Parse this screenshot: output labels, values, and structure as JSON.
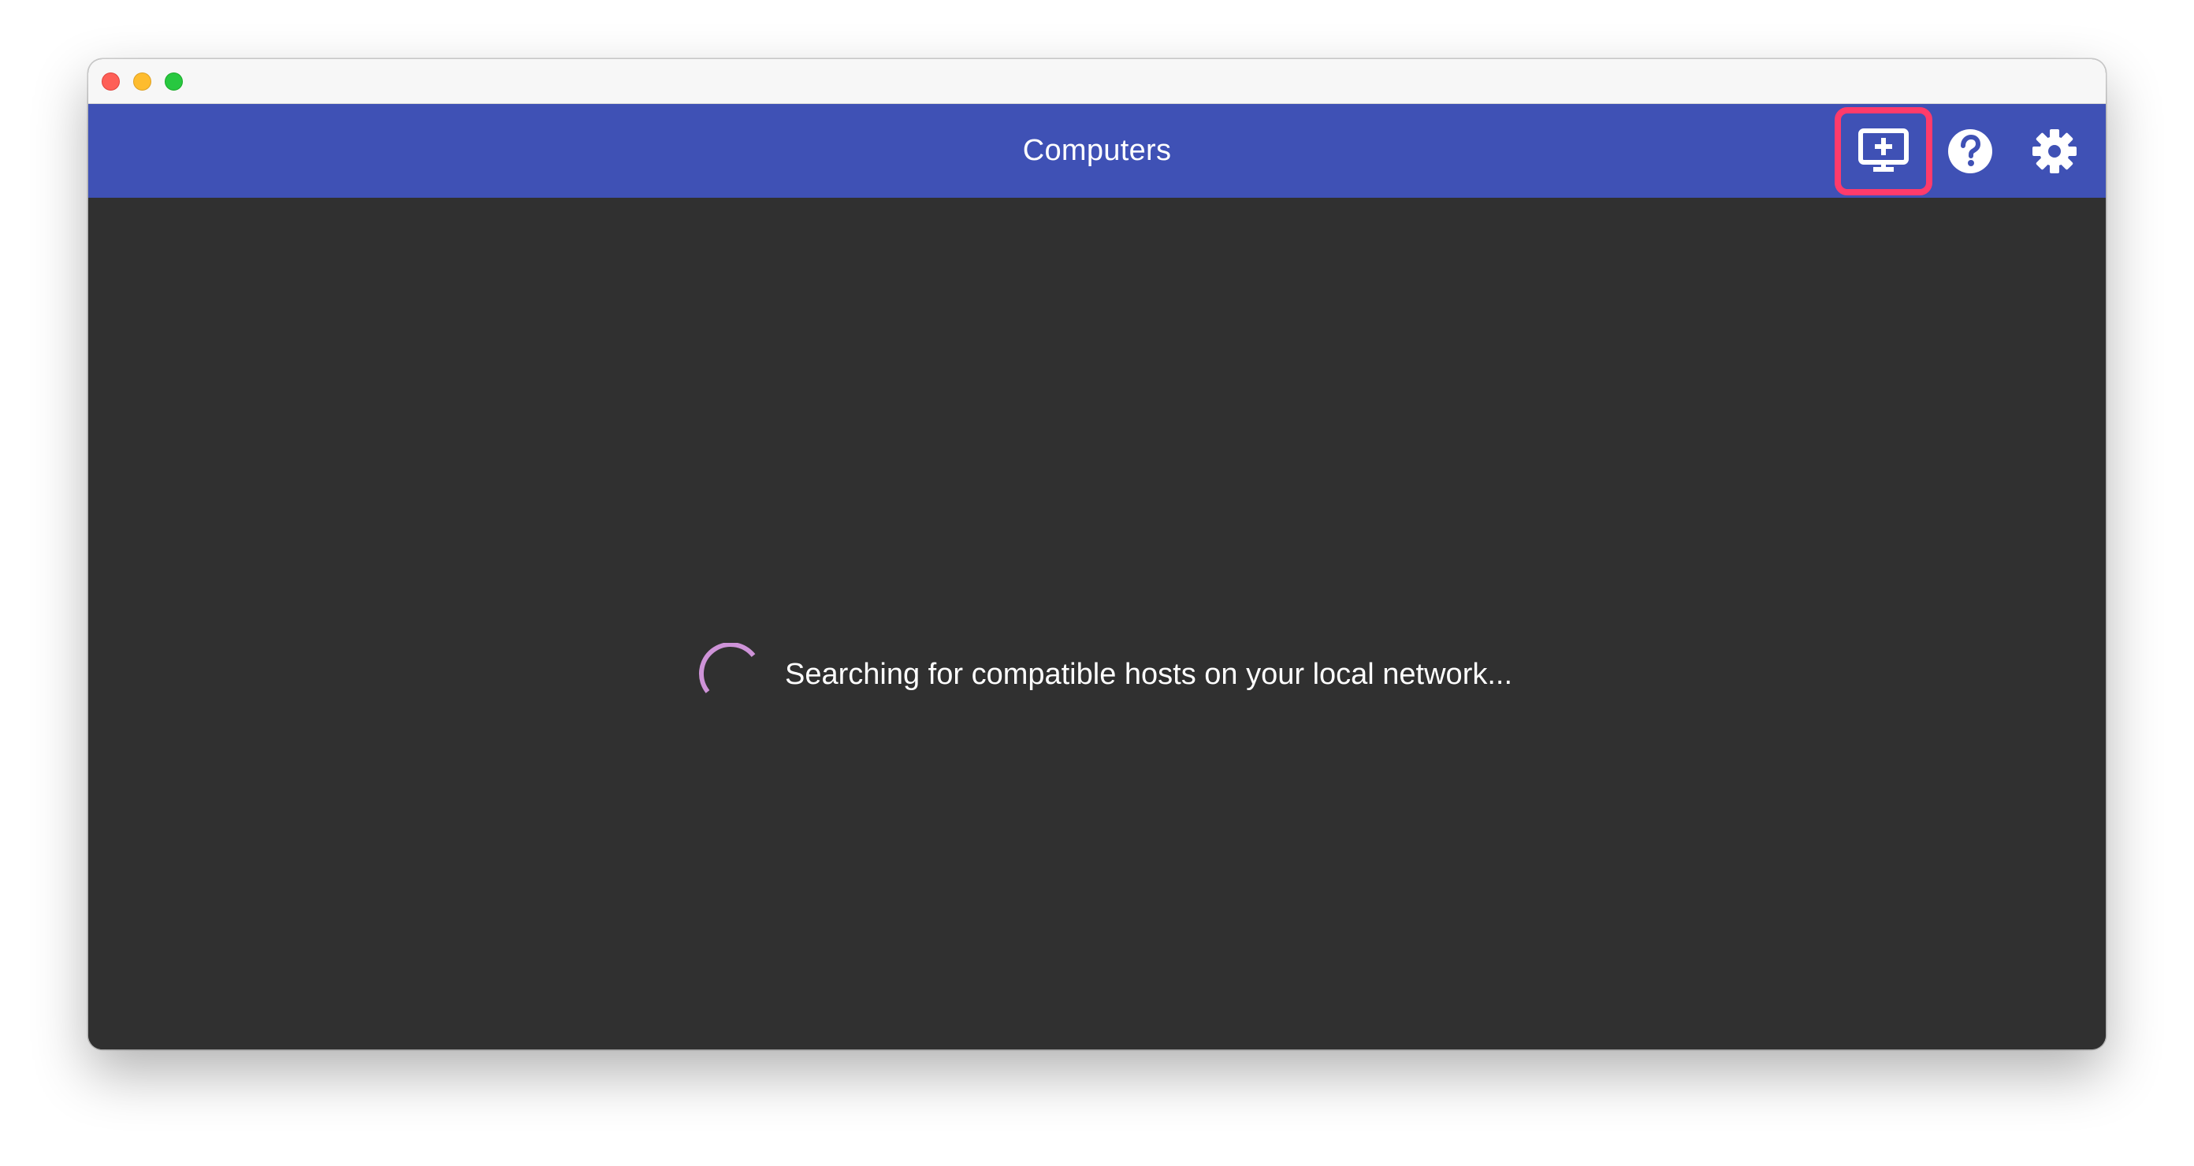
{
  "appbar": {
    "title": "Computers",
    "background_color": "#3f51b5",
    "actions": [
      {
        "name": "add-computer",
        "icon": "monitor-plus-icon",
        "highlighted": true,
        "highlight_color": "#ff3b6b"
      },
      {
        "name": "help",
        "icon": "help-circle-icon"
      },
      {
        "name": "settings",
        "icon": "gear-icon"
      }
    ]
  },
  "content": {
    "background_color": "#303030",
    "status_text": "Searching for compatible hosts on your local network...",
    "spinner_color": "#ce93d8"
  },
  "window": {
    "traffic_lights": [
      "close",
      "minimize",
      "maximize"
    ]
  }
}
